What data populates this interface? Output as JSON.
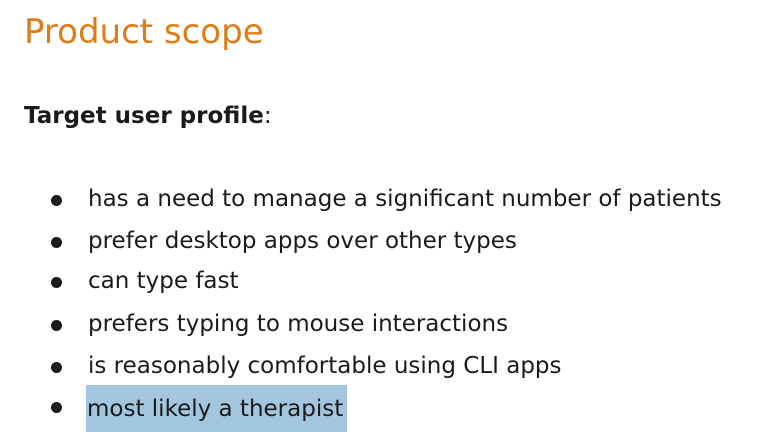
{
  "theme": {
    "heading_color": "#e07c17",
    "text_color": "#1a1a1a",
    "highlight_color": "#a3c6de"
  },
  "heading": {
    "title": "Product scope"
  },
  "target_profile": {
    "label": "Target user profile",
    "suffix": ":",
    "items": [
      {
        "text": "has a need to manage a significant number of patients",
        "highlighted": false
      },
      {
        "text": "prefer desktop apps over other types",
        "highlighted": false
      },
      {
        "text": "can type fast",
        "highlighted": false
      },
      {
        "text": "prefers typing to mouse interactions",
        "highlighted": false
      },
      {
        "text": "is reasonably comfortable using CLI apps",
        "highlighted": false
      },
      {
        "text": "most likely a therapist",
        "highlighted": true
      }
    ]
  }
}
